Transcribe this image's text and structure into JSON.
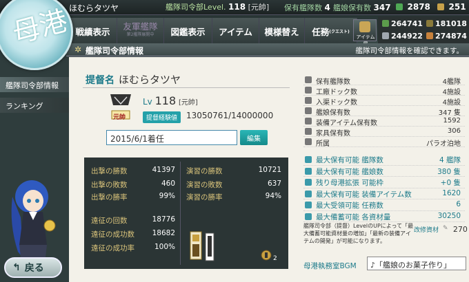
{
  "statusbar": {
    "admiral_name": "ほむらタツヤ",
    "hq_level_label": "艦隊司令部Level.",
    "hq_level": "118",
    "hq_rank": "[元帥]",
    "ships_owned_label": "保有艦隊数",
    "ships_owned": "4",
    "ship_count_label": "艦娘保有数",
    "ship_count": "347",
    "bucket": "2878",
    "dev_material": "251"
  },
  "logo_text": "母港",
  "menu": [
    {
      "label": "戦績表示",
      "dim": false
    },
    {
      "label": "友軍艦隊",
      "dim": true
    },
    {
      "label": "図鑑表示",
      "dim": false
    },
    {
      "label": "アイテム",
      "dim": false
    },
    {
      "label": "模様替え",
      "dim": false
    },
    {
      "label": "任務",
      "dim": false,
      "sub": "(クエスト)"
    }
  ],
  "menu_extra": {
    "item_shop": "アイテム屋",
    "friend_sub": "第2艦隊展開中"
  },
  "resources": {
    "fuel": "264741",
    "ammo": "181018",
    "steel": "244922",
    "bauxite": "274874"
  },
  "titlebar": {
    "title": "艦隊司令部情報",
    "tip": "艦隊司令部情報を確認できます。"
  },
  "sidebar": {
    "items": [
      "艦隊司令部情報",
      "ランキング"
    ]
  },
  "profile": {
    "label": "提督名",
    "name": "ほむらタツヤ",
    "rank_badge": "元帥",
    "lv_label": "Lv",
    "lv": "118",
    "rank": "[元帥]",
    "exp_label": "提督経験値",
    "exp": "13050761/14000000",
    "comment": "2015/6/1着任",
    "edit_label": "編集"
  },
  "record": {
    "left": [
      {
        "label": "出撃の勝数",
        "value": "41397"
      },
      {
        "label": "出撃の敗数",
        "value": "460"
      },
      {
        "label": "出撃の勝率",
        "value": "99%"
      },
      {
        "label": "遠征の回数",
        "value": "18776"
      },
      {
        "label": "遠征の成功数",
        "value": "18682"
      },
      {
        "label": "遠征の成功率",
        "value": "100%"
      }
    ],
    "right": [
      {
        "label": "演習の勝数",
        "value": "10721"
      },
      {
        "label": "演習の敗数",
        "value": "637"
      },
      {
        "label": "演習の勝率",
        "value": "94%"
      }
    ],
    "medal_count": "2"
  },
  "stats": [
    {
      "label": "保有艦隊数",
      "value": "4艦隊"
    },
    {
      "label": "工廠ドック数",
      "value": "4施設"
    },
    {
      "label": "入渠ドック数",
      "value": "4施設"
    },
    {
      "label": "艦娘保有数",
      "value": "347 隻"
    },
    {
      "label": "装備アイテム保有数",
      "value": "1592"
    },
    {
      "label": "家具保有数",
      "value": "306"
    },
    {
      "label": "所属",
      "value": "パラオ泊地"
    }
  ],
  "capacity": [
    {
      "label": "最大保有可能 艦隊数",
      "value": "4 艦隊"
    },
    {
      "label": "最大保有可能 艦娘数",
      "value": "380 隻"
    },
    {
      "label": "残り母港拡張 可能枠",
      "value": "+0 隻"
    },
    {
      "label": "最大保有可能 装備アイテム数",
      "value": "1620"
    },
    {
      "label": "最大受領可能 任務数",
      "value": "6"
    },
    {
      "label": "最大備蓄可能 各資材量",
      "value": "30250"
    }
  ],
  "note": "艦隊司令部（提督）LevelのUPによって「最大備蓄可能資材量の増加」「最新の装備アイテムの開発」が可能になります。",
  "improvement": {
    "label": "改修資材",
    "value": "270"
  },
  "bgm": {
    "label": "母港執務室BGM",
    "value": "♪「艦娘のお菓子作り」"
  },
  "back_label": "戻る",
  "colors": {
    "accent": "#1c7a8a",
    "panel": "#f3f1e9",
    "edit": "#24a1a9"
  }
}
